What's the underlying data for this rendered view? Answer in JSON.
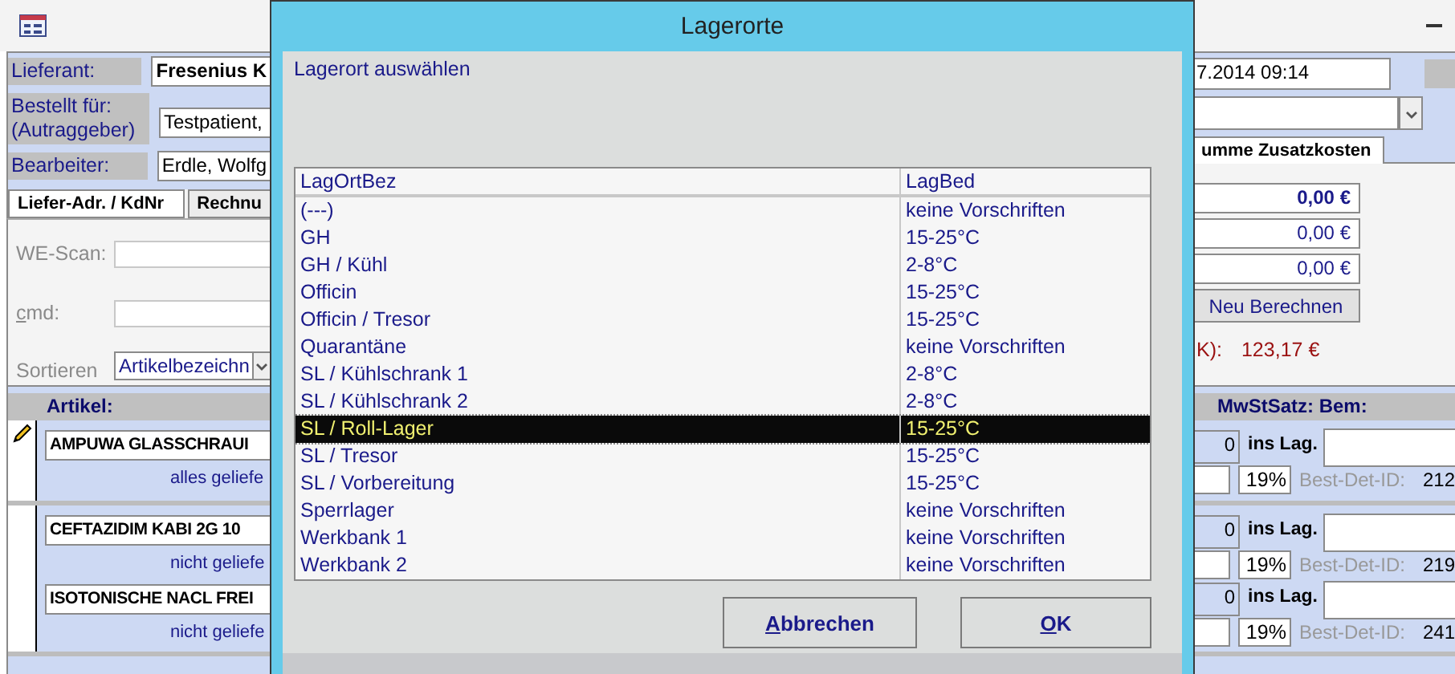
{
  "form": {
    "header_fields": [
      {
        "label": "Lieferant:",
        "value": "Fresenius K"
      },
      {
        "label": "Bestellt für:\n(Autraggeber)",
        "value": "Testpatient,"
      },
      {
        "label": "Bearbeiter:",
        "value": "Erdle, Wolfg"
      }
    ],
    "date_value": "7.2014 09:14",
    "tabs": [
      {
        "label": "Liefer-Adr. / KdNr",
        "selected": true
      },
      {
        "label": "Rechnu",
        "selected": false
      }
    ],
    "right_tabs": [
      {
        "label": "umme Zusatzkosten"
      }
    ],
    "scan_fields": [
      {
        "label": "WE-Scan:"
      },
      {
        "label": "cmd:"
      }
    ],
    "sort": {
      "label": "Sortieren",
      "value": "Artikelbezeichn"
    },
    "amounts": [
      "0,00 €",
      "0,00 €",
      "0,00 €"
    ],
    "recalc_button": "Neu Berechnen",
    "total": {
      "label": "K):",
      "value": "123,17 €"
    },
    "articles": {
      "header": "Artikel:",
      "right_header": "MwStSatz: Bem:",
      "records": [
        {
          "editing": true,
          "lines": [
            {
              "name": "AMPUWA GLASSCHRAUI",
              "status": "alles geliefe",
              "quantity": "0",
              "stock_label": "ins Lag.",
              "vat": "19%",
              "id_label": "Best-Det-ID:",
              "id": "212"
            }
          ]
        },
        {
          "editing": false,
          "lines": [
            {
              "name": "CEFTAZIDIM KABI 2G   10",
              "status": "nicht geliefe",
              "quantity": "0",
              "stock_label": "ins Lag.",
              "vat": "19%",
              "id_label": "Best-Det-ID:",
              "id": "219"
            },
            {
              "name": "ISOTONISCHE NACL FREI",
              "status": "nicht geliefe",
              "quantity": "0",
              "stock_label": "ins Lag.",
              "vat": "19%",
              "id_label": "Best-Det-ID:",
              "id": "241"
            }
          ]
        }
      ]
    }
  },
  "dialog": {
    "title": "Lagerorte",
    "prompt": "Lagerort auswählen",
    "columns": [
      "LagOrtBez",
      "LagBed"
    ],
    "rows": [
      {
        "name": "(---)",
        "condition": "keine Vorschriften",
        "selected": false
      },
      {
        "name": "GH",
        "condition": "15-25°C",
        "selected": false
      },
      {
        "name": "GH / Kühl",
        "condition": "2-8°C",
        "selected": false
      },
      {
        "name": "Officin",
        "condition": "15-25°C",
        "selected": false
      },
      {
        "name": "Officin / Tresor",
        "condition": "15-25°C",
        "selected": false
      },
      {
        "name": "Quarantäne",
        "condition": "keine Vorschriften",
        "selected": false
      },
      {
        "name": "SL / Kühlschrank 1",
        "condition": "2-8°C",
        "selected": false
      },
      {
        "name": "SL / Kühlschrank 2",
        "condition": "2-8°C",
        "selected": false
      },
      {
        "name": "SL / Roll-Lager",
        "condition": "15-25°C",
        "selected": true
      },
      {
        "name": "SL / Tresor",
        "condition": "15-25°C",
        "selected": false
      },
      {
        "name": "SL / Vorbereitung",
        "condition": "15-25°C",
        "selected": false
      },
      {
        "name": "Sperrlager",
        "condition": "keine Vorschriften",
        "selected": false
      },
      {
        "name": "Werkbank 1",
        "condition": "keine Vorschriften",
        "selected": false
      },
      {
        "name": "Werkbank 2",
        "condition": "keine Vorschriften",
        "selected": false
      }
    ],
    "buttons": [
      "Abbrechen",
      "OK"
    ]
  }
}
